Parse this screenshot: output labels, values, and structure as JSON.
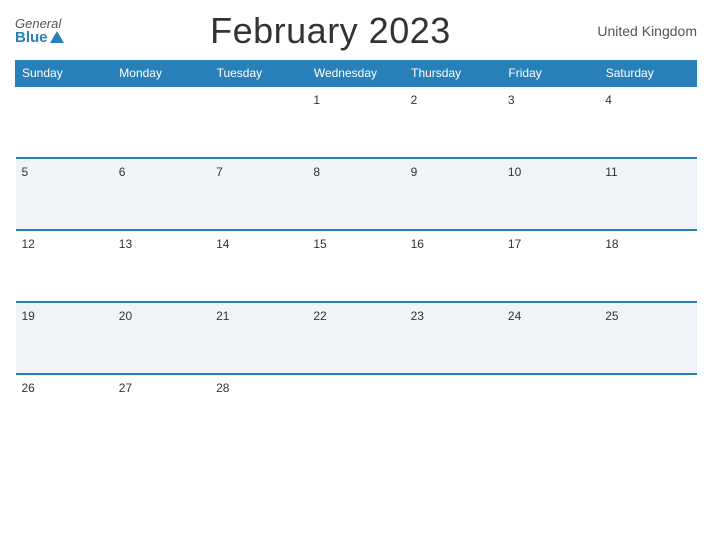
{
  "header": {
    "logo_general": "General",
    "logo_blue": "Blue",
    "title": "February 2023",
    "region": "United Kingdom"
  },
  "days_of_week": [
    "Sunday",
    "Monday",
    "Tuesday",
    "Wednesday",
    "Thursday",
    "Friday",
    "Saturday"
  ],
  "weeks": [
    [
      null,
      null,
      null,
      1,
      2,
      3,
      4
    ],
    [
      5,
      6,
      7,
      8,
      9,
      10,
      11
    ],
    [
      12,
      13,
      14,
      15,
      16,
      17,
      18
    ],
    [
      19,
      20,
      21,
      22,
      23,
      24,
      25
    ],
    [
      26,
      27,
      28,
      null,
      null,
      null,
      null
    ]
  ],
  "colors": {
    "header_bg": "#2980b9",
    "accent": "#2980b9"
  }
}
